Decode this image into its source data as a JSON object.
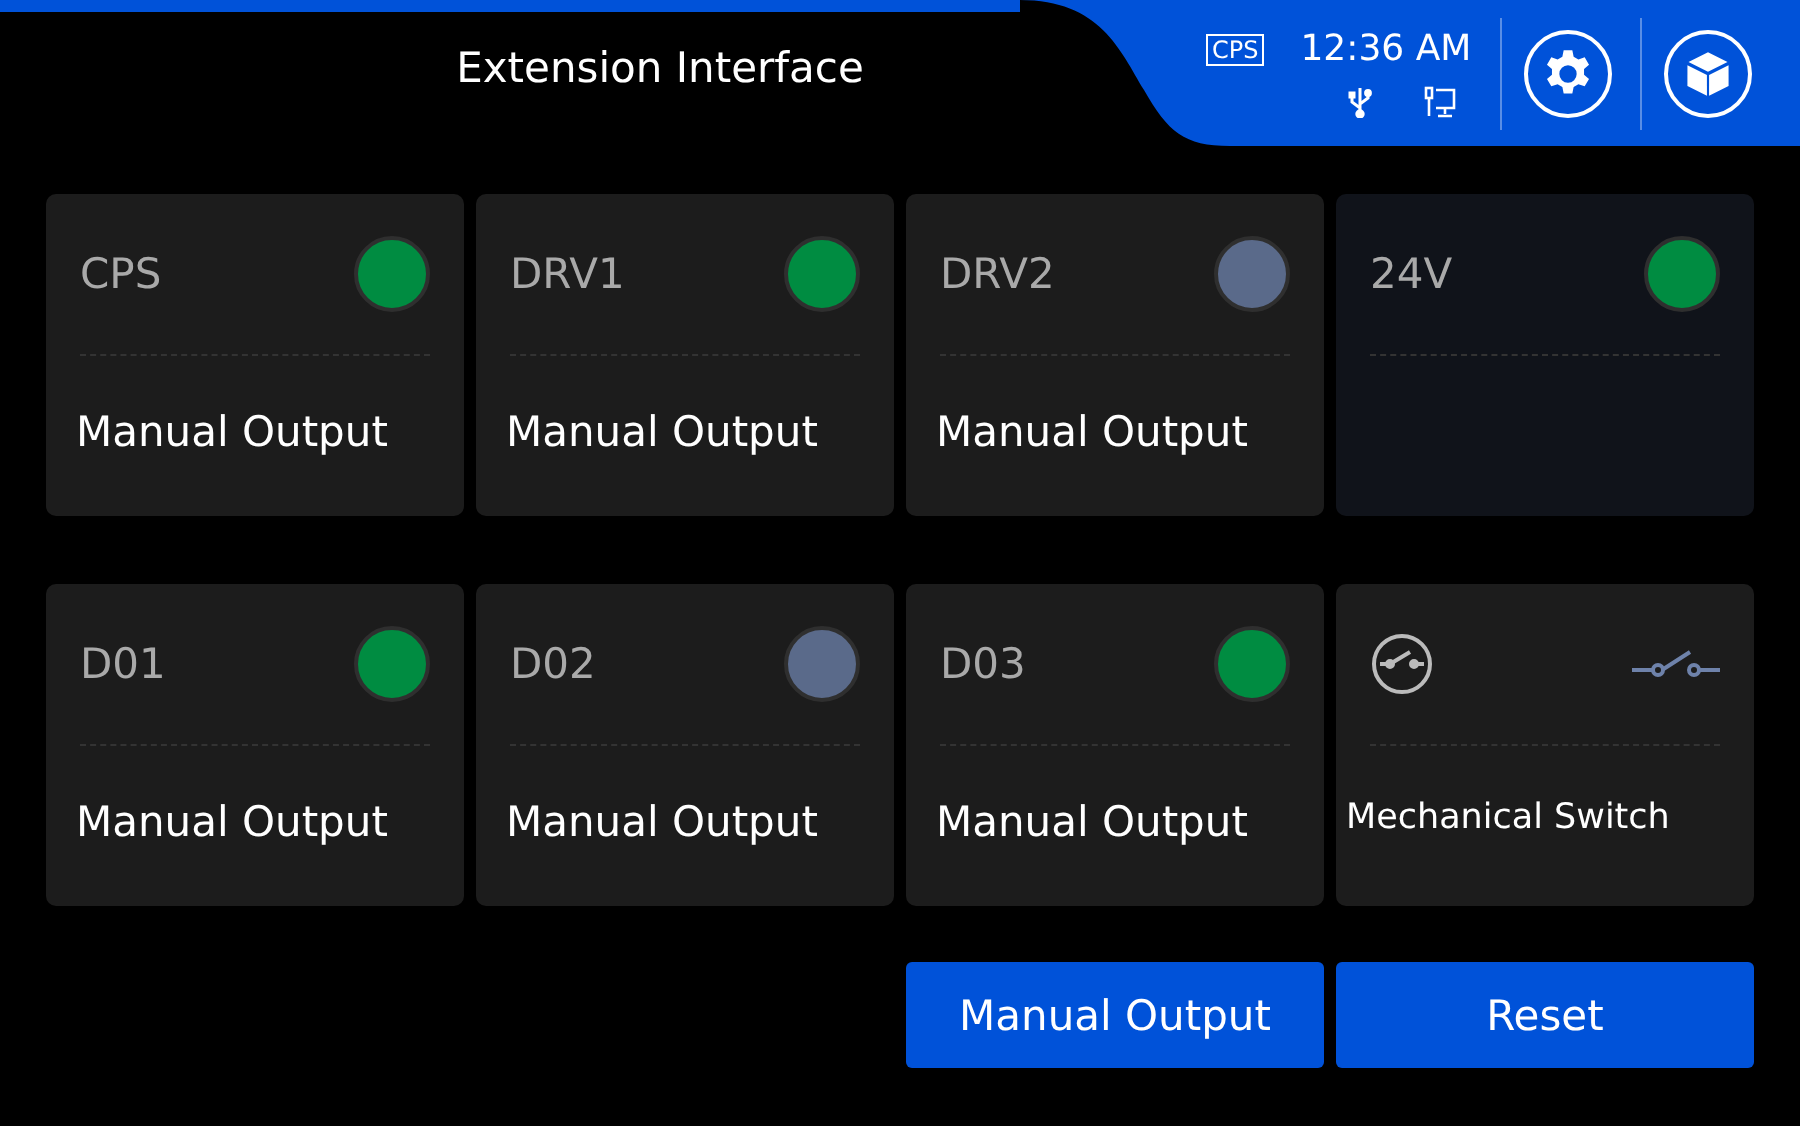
{
  "header": {
    "title": "Extension Interface",
    "badge": "CPS",
    "time": "12:36 AM"
  },
  "cards": [
    {
      "kind": "output",
      "label": "CPS",
      "on": true,
      "action": "Manual Output"
    },
    {
      "kind": "output",
      "label": "DRV1",
      "on": true,
      "action": "Manual Output"
    },
    {
      "kind": "output",
      "label": "DRV2",
      "on": false,
      "action": "Manual Output"
    },
    {
      "kind": "power",
      "label": "24V",
      "on": true
    },
    {
      "kind": "output",
      "label": "D01",
      "on": true,
      "action": "Manual Output"
    },
    {
      "kind": "output",
      "label": "D02",
      "on": false,
      "action": "Manual Output"
    },
    {
      "kind": "output",
      "label": "D03",
      "on": true,
      "action": "Manual Output"
    },
    {
      "kind": "switch",
      "action": "Mechanical Switch"
    }
  ],
  "buttons": [
    "Manual Output",
    "Reset"
  ]
}
